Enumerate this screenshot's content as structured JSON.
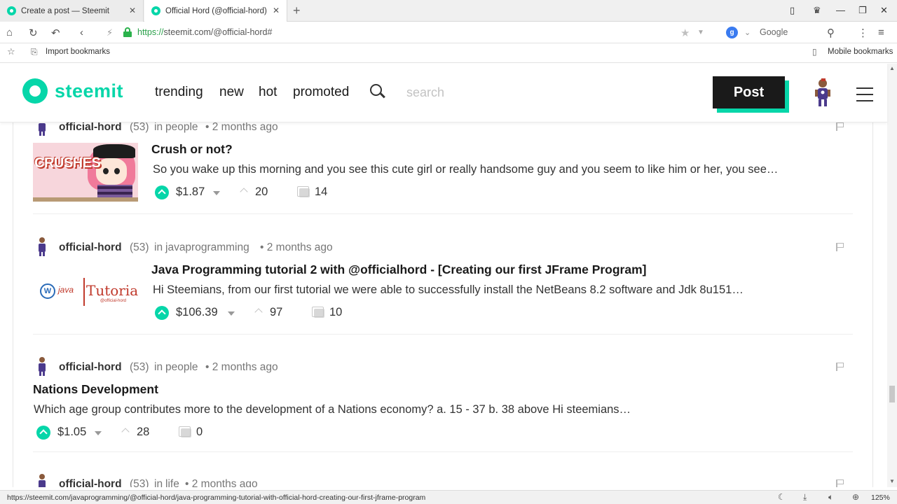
{
  "browser": {
    "tabs": [
      {
        "title": "Create a post — Steemit",
        "close": "✕"
      },
      {
        "title": "Official Hord (@official-hord)",
        "close": "✕"
      }
    ],
    "new_tab": "+",
    "url_scheme": "https://",
    "url_host": "steemit.com/@official-hord#",
    "search_engine_badge": "g",
    "search_engine": "Google",
    "bookmarks": {
      "import": "Import bookmarks",
      "mobile": "Mobile bookmarks"
    },
    "status_url": "https://steemit.com/javaprogramming/@official-hord/java-programming-tutorial-with-official-hord-creating-our-first-jframe-program",
    "zoom": "125%"
  },
  "site": {
    "logo": "steemit",
    "nav": [
      "trending",
      "new",
      "hot",
      "promoted"
    ],
    "search_placeholder": "search",
    "post_button": "Post",
    "accent": "#06d6a9",
    "dark": "#1a1a1a"
  },
  "posts": [
    {
      "author": "official-hord",
      "rep": "(53)",
      "in": "in",
      "category": "people",
      "age": "• 2 months ago",
      "title": "Crush or not?",
      "summary": "So you wake up this morning and you see this cute girl or really handsome guy and you seem to like him or her, you see…",
      "thumb_text": "CRUSHES",
      "payout": "$1.87",
      "votes": "20",
      "comments": "14"
    },
    {
      "author": "official-hord",
      "rep": "(53)",
      "in": "in",
      "category": "javaprogramming",
      "age": "• 2 months ago",
      "title": "Java Programming tutorial 2 with @officialhord - [Creating our first JFrame Program]",
      "summary": "Hi Steemians, from our first tutorial we were able to successfully install the NetBeans 8.2 software and Jdk 8u151…",
      "thumb_text": "Tutorial",
      "thumb_small": "java",
      "thumb_sign": "@official-hord",
      "payout": "$106.39",
      "votes": "97",
      "comments": "10"
    },
    {
      "author": "official-hord",
      "rep": "(53)",
      "in": "in",
      "category": "people",
      "age": "• 2 months ago",
      "title": "Nations Development",
      "summary": "Which age group contributes more to the development of a Nations economy? a. 15 - 37 b. 38 above Hi steemians…",
      "payout": "$1.05",
      "votes": "28",
      "comments": "0"
    },
    {
      "author": "official-hord",
      "rep": "(53)",
      "in": "in",
      "category": "life",
      "age": "• 2 months ago"
    }
  ]
}
